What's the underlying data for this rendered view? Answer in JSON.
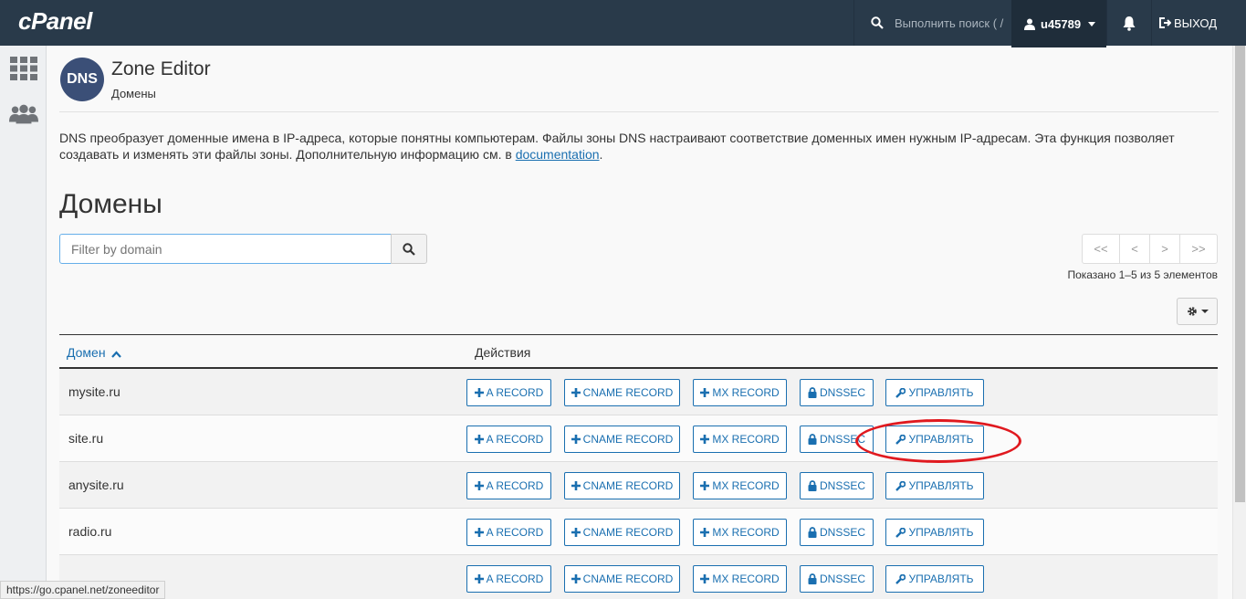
{
  "topbar": {
    "logo": "cPanel",
    "search_placeholder": "Выполнить поиск ( /",
    "username": "u45789",
    "logout_label": "ВЫХОД"
  },
  "header": {
    "icon_text": "DNS",
    "title": "Zone Editor",
    "breadcrumb": "Домены"
  },
  "description": {
    "text": "DNS преобразует доменные имена в IP-адреса, которые понятны компьютерам. Файлы зоны DNS настраивают соответствие доменных имен нужным IP-адресам. Эта функция позволяет создавать и изменять эти файлы зоны. Дополнительную информацию см. в ",
    "link": "documentation",
    "end": "."
  },
  "section_title": "Домены",
  "filter": {
    "placeholder": "Filter by domain"
  },
  "pagination": {
    "first": "<<",
    "prev": "<",
    "next": ">",
    "last": ">>",
    "info": "Показано 1–5 из 5 элементов"
  },
  "table": {
    "col_domain": "Домен",
    "col_actions": "Действия",
    "actions": {
      "a_record": "A RECORD",
      "cname_record": "CNAME RECORD",
      "mx_record": "MX RECORD",
      "dnssec": "DNSSEC",
      "manage": "УПРАВЛЯТЬ"
    },
    "rows": [
      {
        "domain": "mysite.ru"
      },
      {
        "domain": "site.ru"
      },
      {
        "domain": "anysite.ru"
      },
      {
        "domain": "radio.ru"
      },
      {
        "domain": ""
      }
    ]
  },
  "status_bar": "https://go.cpanel.net/zoneeditor",
  "colors": {
    "topbar": "#293a4a",
    "link": "#1a6fb0",
    "highlight": "#e0191f"
  }
}
